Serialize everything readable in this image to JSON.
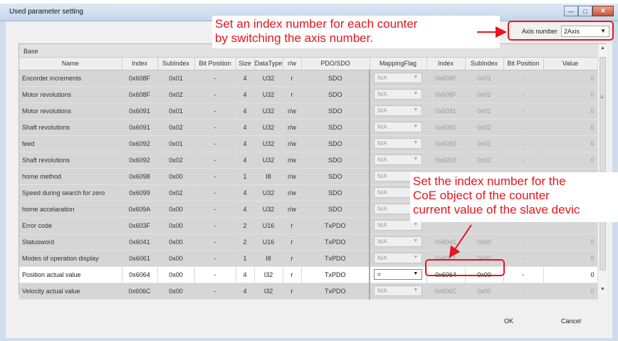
{
  "window": {
    "title": "Used parameter setting",
    "controls": [
      "minimize-icon",
      "maximize-icon",
      "close-icon"
    ]
  },
  "axis": {
    "label": "Axis number",
    "value": "2Axis"
  },
  "grid": {
    "band_left": "Base",
    "band_right_partial": "",
    "columns": [
      "Name",
      "Index",
      "SubIndex",
      "Bit Position",
      "Size",
      "DataType",
      "r/w",
      "PDO/SDO",
      "MappingFlag",
      "Index",
      "SubIndex",
      "Bit Position",
      "Value"
    ],
    "rows": [
      {
        "name": "Encorder increments",
        "index": "0x608F",
        "subindex": "0x01",
        "bitpos": "-",
        "size": "4",
        "dtype": "U32",
        "rw": "r",
        "pdo": "SDO",
        "flag": "N/A",
        "r_index": "0x608F",
        "r_sub": "0x01",
        "r_bit": "-",
        "value": "0"
      },
      {
        "name": "Motor revolutions",
        "index": "0x608F",
        "subindex": "0x02",
        "bitpos": "-",
        "size": "4",
        "dtype": "U32",
        "rw": "r",
        "pdo": "SDO",
        "flag": "N/A",
        "r_index": "0x608F",
        "r_sub": "0x02",
        "r_bit": "-",
        "value": "0"
      },
      {
        "name": "Motor revolutions",
        "index": "0x6091",
        "subindex": "0x01",
        "bitpos": "-",
        "size": "4",
        "dtype": "U32",
        "rw": "r/w",
        "pdo": "SDO",
        "flag": "N/A",
        "r_index": "0x6091",
        "r_sub": "0x01",
        "r_bit": "-",
        "value": "0"
      },
      {
        "name": "Shaft revolutions",
        "index": "0x6091",
        "subindex": "0x02",
        "bitpos": "-",
        "size": "4",
        "dtype": "U32",
        "rw": "r/w",
        "pdo": "SDO",
        "flag": "N/A",
        "r_index": "0x6091",
        "r_sub": "0x02",
        "r_bit": "-",
        "value": "0"
      },
      {
        "name": "feed",
        "index": "0x6092",
        "subindex": "0x01",
        "bitpos": "-",
        "size": "4",
        "dtype": "U32",
        "rw": "r/w",
        "pdo": "SDO",
        "flag": "N/A",
        "r_index": "0x6092",
        "r_sub": "0x01",
        "r_bit": "-",
        "value": "0"
      },
      {
        "name": "Shaft revolutions",
        "index": "0x6092",
        "subindex": "0x02",
        "bitpos": "-",
        "size": "4",
        "dtype": "U32",
        "rw": "r/w",
        "pdo": "SDO",
        "flag": "N/A",
        "r_index": "0x6092",
        "r_sub": "0x02",
        "r_bit": "-",
        "value": "0"
      },
      {
        "name": "home method",
        "index": "0x6098",
        "subindex": "0x00",
        "bitpos": "-",
        "size": "1",
        "dtype": "I8",
        "rw": "r/w",
        "pdo": "SDO",
        "flag": "N/A",
        "r_index": "",
        "r_sub": "",
        "r_bit": "",
        "value": ""
      },
      {
        "name": "Speed during search for zero",
        "index": "0x6099",
        "subindex": "0x02",
        "bitpos": "-",
        "size": "4",
        "dtype": "U32",
        "rw": "r/w",
        "pdo": "SDO",
        "flag": "N/A",
        "r_index": "",
        "r_sub": "",
        "r_bit": "",
        "value": ""
      },
      {
        "name": "home accelaration",
        "index": "0x609A",
        "subindex": "0x00",
        "bitpos": "-",
        "size": "4",
        "dtype": "U32",
        "rw": "r/w",
        "pdo": "SDO",
        "flag": "N/A",
        "r_index": "",
        "r_sub": "",
        "r_bit": "",
        "value": ""
      },
      {
        "name": "Error code",
        "index": "0x603F",
        "subindex": "0x00",
        "bitpos": "-",
        "size": "2",
        "dtype": "U16",
        "rw": "r",
        "pdo": "TxPDO",
        "flag": "N/A",
        "r_index": "",
        "r_sub": "",
        "r_bit": "",
        "value": ""
      },
      {
        "name": "Statusword",
        "index": "0x6041",
        "subindex": "0x00",
        "bitpos": "-",
        "size": "2",
        "dtype": "U16",
        "rw": "r",
        "pdo": "TxPDO",
        "flag": "N/A",
        "r_index": "0x6041",
        "r_sub": "0x00",
        "r_bit": "-",
        "value": "0"
      },
      {
        "name": "Modes of operation display",
        "index": "0x6061",
        "subindex": "0x00",
        "bitpos": "-",
        "size": "1",
        "dtype": "I8",
        "rw": "r",
        "pdo": "TxPDO",
        "flag": "N/A",
        "r_index": "0x6061",
        "r_sub": "0x00",
        "r_bit": "-",
        "value": "0"
      },
      {
        "name": "Position actual value",
        "index": "0x6064",
        "subindex": "0x00",
        "bitpos": "-",
        "size": "4",
        "dtype": "I32",
        "rw": "r",
        "pdo": "TxPDO",
        "flag": "=",
        "r_index": "0x6064",
        "r_sub": "0x00",
        "r_bit": "-",
        "value": "0"
      },
      {
        "name": "Velocity actual value",
        "index": "0x606C",
        "subindex": "0x00",
        "bitpos": "-",
        "size": "4",
        "dtype": "I32",
        "rw": "r",
        "pdo": "TxPDO",
        "flag": "N/A",
        "r_index": "0x606C",
        "r_sub": "0x00",
        "r_bit": "-",
        "value": "0"
      }
    ]
  },
  "buttons": {
    "ok": "OK",
    "cancel": "Cancel"
  },
  "annotations": {
    "top_line1": "Set an index number for each counter",
    "top_line2": "by switching the axis number.",
    "mid_line1": "Set the index number for the",
    "mid_line2": "CoE object of the counter",
    "mid_line3": "current value of the slave devic"
  },
  "colors": {
    "annotation": "#e8141c",
    "grid_gray": "#d6d6d6",
    "titlebar": "#c4d5ea"
  }
}
